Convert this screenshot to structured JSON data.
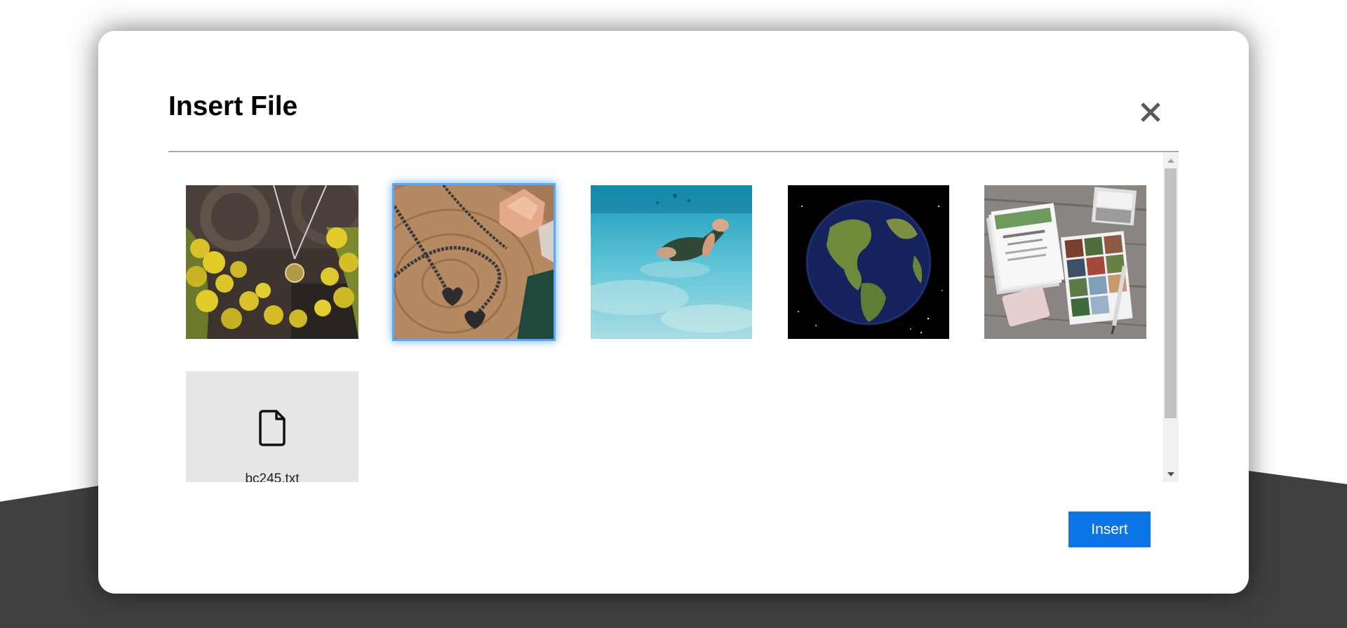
{
  "dialog": {
    "title": "Insert File",
    "close_icon": "close-icon",
    "insert_label": "Insert"
  },
  "files": [
    {
      "kind": "image",
      "subject": "necklace with yellow flowers",
      "selected": false
    },
    {
      "kind": "image",
      "subject": "heart pendant chain on wood slice",
      "selected": true
    },
    {
      "kind": "image",
      "subject": "swimmer underwater",
      "selected": false
    },
    {
      "kind": "image",
      "subject": "planet earth in space",
      "selected": false
    },
    {
      "kind": "image",
      "subject": "printed cards on wooden table",
      "selected": false
    },
    {
      "kind": "file",
      "name": "bc245.txt",
      "icon": "file-icon",
      "selected": false
    }
  ],
  "colors": {
    "accent": "#0b74e6",
    "selection_glow": "#5aa6ff",
    "backdrop_dark": "#404040",
    "file_tile_bg": "#e6e6e6"
  }
}
